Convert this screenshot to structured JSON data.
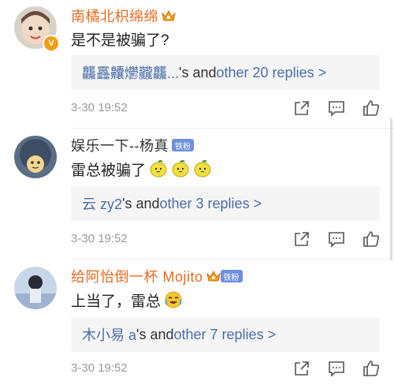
{
  "comments": [
    {
      "username": "南橘北枳绵绵",
      "text": "是不是被骗了?",
      "reply_user": "龘靐齉爩龖龘...",
      "reply_mid": "'s and ",
      "reply_link": "other 20 replies >",
      "time": "3-30 19:52",
      "badge": "",
      "avatar_badge": "V"
    },
    {
      "username": "娱乐一下--杨真",
      "text": "雷总被骗了",
      "reply_user": "云 zy2",
      "reply_mid": "'s and ",
      "reply_link": "other 3 replies >",
      "time": "3-30 19:52",
      "badge": "铁粉",
      "avatar_badge": ""
    },
    {
      "username": "给阿怡倒一杯 Mojito",
      "text": "上当了，雷总",
      "reply_user": "木小易 a",
      "reply_mid": "'s and ",
      "reply_link": "other 7 replies >",
      "time": "3-30 19:52",
      "badge": "铁粉",
      "avatar_badge": ""
    }
  ],
  "icons": {
    "share": "share-icon",
    "comment": "comment-icon",
    "like": "thumbs-up-icon"
  },
  "colors": {
    "username": "#e86b22",
    "reply_link": "#4a6ea9",
    "meta": "#999999",
    "badge": "#6f8fe0"
  }
}
